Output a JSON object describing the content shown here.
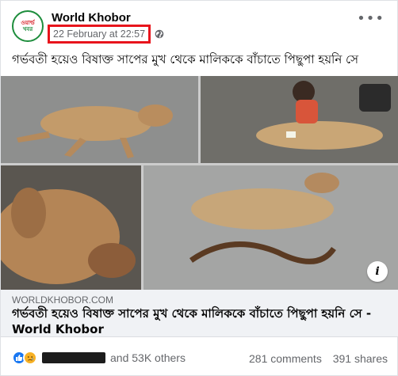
{
  "post": {
    "page_name": "World Khobor",
    "avatar_line1": "ওয়ার্ল্ড",
    "avatar_line2": "খবর",
    "timestamp": "22 February at 22:57",
    "caption": "গর্ভবতী হয়েও বিষাক্ত সাপের মুখ থেকে মালিককে বাঁচাতে পিছুপা হয়নি সে"
  },
  "link_preview": {
    "domain": "WORLDKHOBOR.COM",
    "title": "গর্ভবতী হয়েও বিষাক্ত সাপের মুখ থেকে মালিককে বাঁচাতে পিছুপা হয়নি সে - World Khobor",
    "info_icon_glyph": "i"
  },
  "footer": {
    "reactions_others": "and 53K others",
    "comments": "281 comments",
    "shares": "391 shares"
  },
  "icons": {
    "more": "more-options-icon",
    "globe": "globe-icon",
    "like": "like-reaction-icon",
    "sad": "sad-reaction-icon"
  },
  "colors": {
    "highlight_box": "#e8141c",
    "brand_blue": "#1877f2",
    "sad_yellow": "#f7b125"
  }
}
